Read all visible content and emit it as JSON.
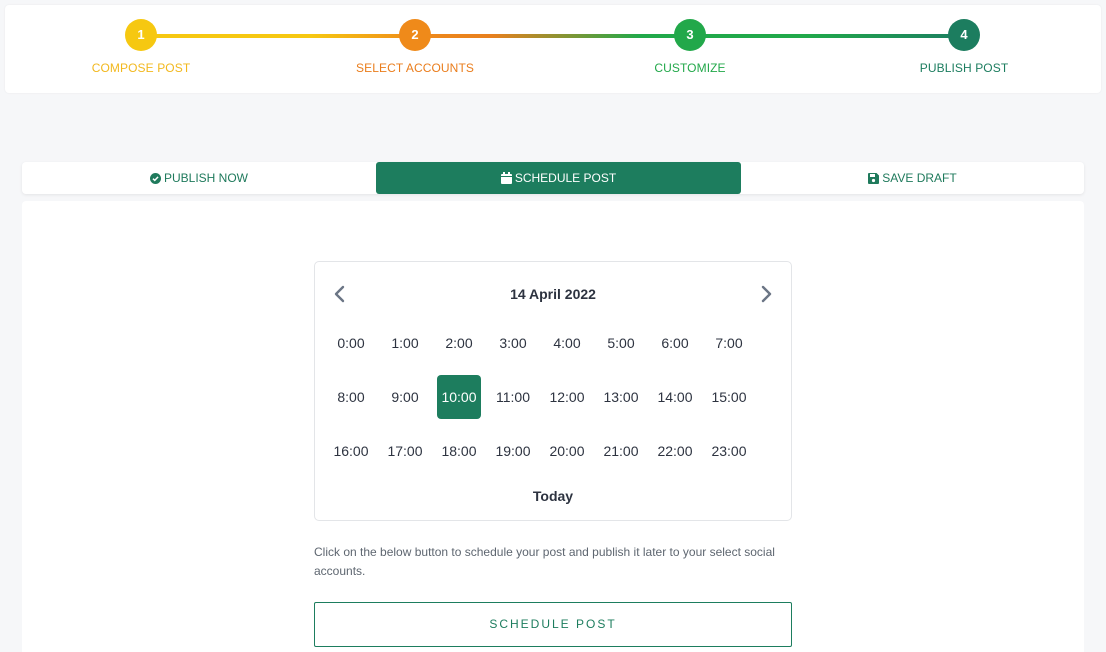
{
  "stepper": {
    "steps": [
      {
        "number": "1",
        "label": "COMPOSE POST",
        "color": "#f6c811",
        "label_color": "#f2b81e"
      },
      {
        "number": "2",
        "label": "SELECT ACCOUNTS",
        "color": "#ef8a1a",
        "label_color": "#ea7d1c"
      },
      {
        "number": "3",
        "label": "CUSTOMIZE",
        "color": "#22a84a",
        "label_color": "#22a84a"
      },
      {
        "number": "4",
        "label": "PUBLISH POST",
        "color": "#1c7d5f",
        "label_color": "#1c7d5f"
      }
    ]
  },
  "tabs": {
    "publish_now": {
      "label": "PUBLISH NOW",
      "icon": "check-circle-icon"
    },
    "schedule_post": {
      "label": "SCHEDULE POST",
      "icon": "calendar-icon",
      "active": true
    },
    "save_draft": {
      "label": "SAVE DRAFT",
      "icon": "floppy-disk-icon"
    }
  },
  "calendar": {
    "date": "14 April 2022",
    "prev_icon": "chevron-left-icon",
    "next_icon": "chevron-right-icon",
    "hours": [
      "0:00",
      "1:00",
      "2:00",
      "3:00",
      "4:00",
      "5:00",
      "6:00",
      "7:00",
      "8:00",
      "9:00",
      "10:00",
      "11:00",
      "12:00",
      "13:00",
      "14:00",
      "15:00",
      "16:00",
      "17:00",
      "18:00",
      "19:00",
      "20:00",
      "21:00",
      "22:00",
      "23:00"
    ],
    "selected_hour": "10:00",
    "today_label": "Today"
  },
  "help_text": "Click on the below button to schedule your post and publish it later to your select social accounts.",
  "schedule_button": {
    "label": "SCHEDULE POST"
  },
  "colors": {
    "accent": "#1d7d5e",
    "text": "#2d3340",
    "muted": "#5e6670"
  }
}
